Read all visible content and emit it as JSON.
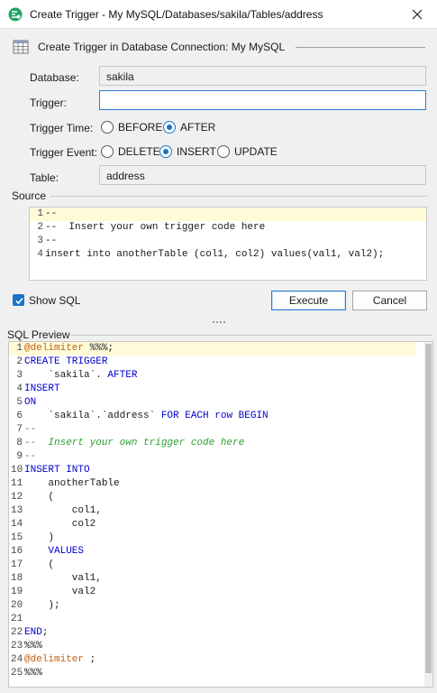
{
  "window": {
    "title": "Create Trigger - My MySQL/Databases/sakila/Tables/address",
    "icon": "app-logo-icon",
    "close_icon": "close-icon"
  },
  "header": {
    "text": "Create Trigger in Database Connection: My MySQL",
    "icon": "database-table-icon"
  },
  "form": {
    "database_label": "Database:",
    "database_value": "sakila",
    "trigger_label": "Trigger:",
    "trigger_value": "",
    "trigger_time_label": "Trigger Time:",
    "trigger_time_options": [
      "BEFORE",
      "AFTER"
    ],
    "trigger_time_selected": "AFTER",
    "trigger_event_label": "Trigger Event:",
    "trigger_event_options": [
      "DELETE",
      "INSERT",
      "UPDATE"
    ],
    "trigger_event_selected": "INSERT",
    "table_label": "Table:",
    "table_value": "address"
  },
  "source": {
    "label": "Source",
    "lines": [
      "--",
      "--  Insert your own trigger code here",
      "--",
      "insert into anotherTable (col1, col2) values(val1, val2);"
    ]
  },
  "controls": {
    "show_sql_label": "Show SQL",
    "show_sql_checked": true,
    "execute_label": "Execute",
    "cancel_label": "Cancel"
  },
  "preview": {
    "label": "SQL Preview",
    "lines": [
      [
        {
          "t": "@delimiter",
          "c": "dir"
        },
        {
          "t": " %%%;",
          "c": ""
        }
      ],
      [
        {
          "t": "CREATE TRIGGER",
          "c": "kw"
        }
      ],
      [
        {
          "t": "    `sakila`. ",
          "c": ""
        },
        {
          "t": "AFTER",
          "c": "kw"
        }
      ],
      [
        {
          "t": "INSERT",
          "c": "kw"
        }
      ],
      [
        {
          "t": "ON",
          "c": "kw"
        }
      ],
      [
        {
          "t": "    `sakila`.`address` ",
          "c": ""
        },
        {
          "t": "FOR EACH row BEGIN",
          "c": "kw"
        }
      ],
      [
        {
          "t": "--",
          "c": "cmp"
        }
      ],
      [
        {
          "t": "--  Insert your own trigger code here",
          "c": "cm"
        }
      ],
      [
        {
          "t": "--",
          "c": "cmp"
        }
      ],
      [
        {
          "t": "INSERT INTO",
          "c": "kw"
        }
      ],
      [
        {
          "t": "    anotherTable",
          "c": ""
        }
      ],
      [
        {
          "t": "    (",
          "c": ""
        }
      ],
      [
        {
          "t": "        col1,",
          "c": ""
        }
      ],
      [
        {
          "t": "        col2",
          "c": ""
        }
      ],
      [
        {
          "t": "    )",
          "c": ""
        }
      ],
      [
        {
          "t": "    VALUES",
          "c": "kw"
        }
      ],
      [
        {
          "t": "    (",
          "c": ""
        }
      ],
      [
        {
          "t": "        val1,",
          "c": ""
        }
      ],
      [
        {
          "t": "        val2",
          "c": ""
        }
      ],
      [
        {
          "t": "    );",
          "c": ""
        }
      ],
      [
        {
          "t": "",
          "c": ""
        }
      ],
      [
        {
          "t": "END",
          "c": "kw"
        },
        {
          "t": ";",
          "c": ""
        }
      ],
      [
        {
          "t": "%%%",
          "c": ""
        }
      ],
      [
        {
          "t": "@delimiter",
          "c": "dir"
        },
        {
          "t": " ;",
          "c": ""
        }
      ],
      [
        {
          "t": "%%%",
          "c": ""
        }
      ]
    ]
  },
  "colors": {
    "accent": "#1a73c8",
    "keyword": "#0000cc",
    "directive": "#c06010",
    "comment": "#2d9e2d",
    "line_highlight": "#fffbd9"
  }
}
